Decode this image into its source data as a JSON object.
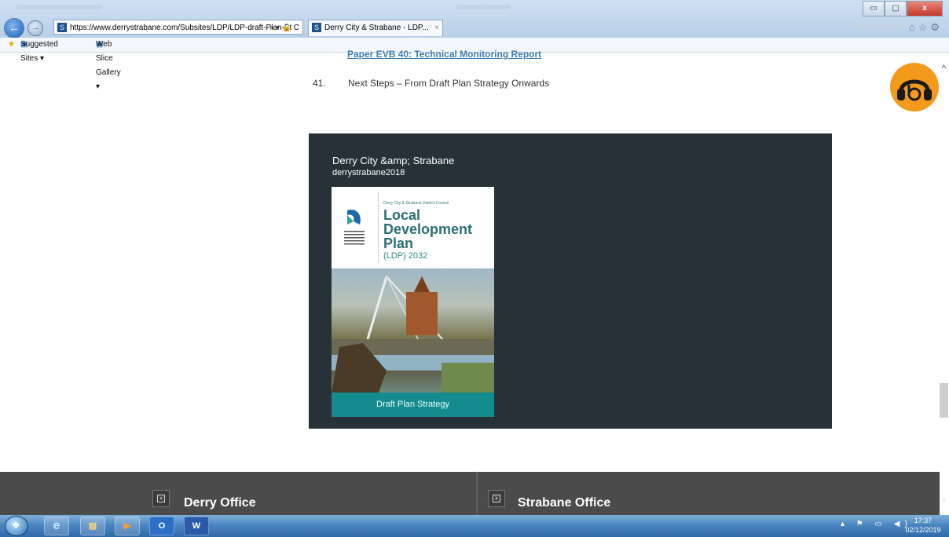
{
  "browser": {
    "address_url": "https://www.derrystrabane.com/Subsites/LDP/LDP-draft-Plan-St",
    "address_icons": "⌕ ▾ 🔒 C",
    "tab_title": "Derry City & Strabane - LDP...",
    "tab_close": "×",
    "favorites": {
      "suggested_sites": "Suggested Sites ▾",
      "web_slice_gallery": "Web Slice Gallery ▾"
    },
    "window_controls": {
      "minimize": "▭",
      "maximize": "▢",
      "close": "x"
    },
    "right_icons": "⌂☆⚙"
  },
  "page": {
    "partial_link": "Paper EVB 40: Technical Monitoring Report",
    "list_item": {
      "number": "41.",
      "text": "Next Steps – From Draft Plan Strategy Onwards"
    },
    "embed": {
      "account_name": "Derry City &amp; Strabane",
      "handle": "derrystrabane2018",
      "cover": {
        "council_line": "Derry City & Strabane District Council",
        "title_line1": "Local",
        "title_line2": "Development",
        "title_line3": "Plan",
        "subtitle": "(LDP) 2032",
        "footer": "Draft Plan Strategy"
      }
    },
    "footer": {
      "left_office": "Derry Office",
      "right_office": "Strabane Office"
    },
    "scroll": {
      "up": "^",
      "down": "˅"
    }
  },
  "taskbar": {
    "outlook_label": "O",
    "word_label": "W",
    "tray": "▴ ⚑ ▭ ◀)",
    "time": "17:37",
    "date": "02/12/2019"
  },
  "colors": {
    "embed_background": "#263238",
    "cover_footer": "#148b8f",
    "cover_title": "#2c6f73",
    "footer_band": "#4b4b4b",
    "badge_orange": "#f39a1c",
    "link": "#3f7db0"
  }
}
